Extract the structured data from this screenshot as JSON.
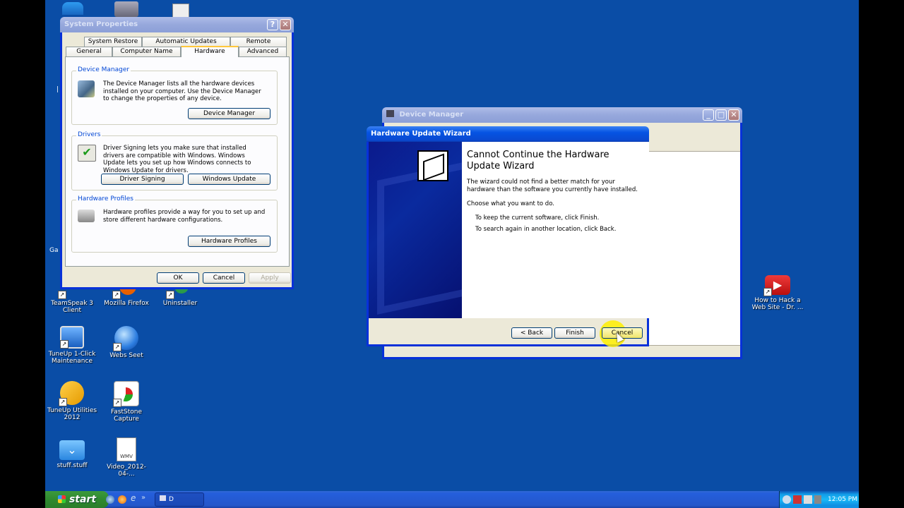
{
  "desktop_icons": [
    {
      "label": "TeamSpeak 3 Client",
      "icon": "teamspeak-icon"
    },
    {
      "label": "Mozilla Firefox",
      "icon": "firefox-icon"
    },
    {
      "label": "Uninstaller",
      "icon": "uninstaller-icon"
    },
    {
      "label": "TuneUp 1-Click Maintenance",
      "icon": "tuneup-maintenance-icon"
    },
    {
      "label": "Webs Seet",
      "icon": "globe-icon"
    },
    {
      "label": "TuneUp Utilities 2012",
      "icon": "tuneup-utilities-icon"
    },
    {
      "label": "FastStone Capture",
      "icon": "faststone-icon"
    },
    {
      "label": "stuff.stuff",
      "icon": "folder-download-icon"
    },
    {
      "label": "Video_2012-04-...",
      "icon": "wmv-file-icon"
    },
    {
      "label": "How to Hack a Web Site - Dr. ...",
      "icon": "youtube-icon"
    }
  ],
  "partial_desktop_label": "Ga",
  "system_properties": {
    "title": "System Properties",
    "tabs_top": [
      "System Restore",
      "Automatic Updates",
      "Remote"
    ],
    "tabs_bottom": [
      "General",
      "Computer Name",
      "Hardware",
      "Advanced"
    ],
    "active_tab": "Hardware",
    "device_manager": {
      "title": "Device Manager",
      "text": "The Device Manager lists all the hardware devices installed on your computer. Use the Device Manager to change the properties of any device.",
      "button": "Device Manager"
    },
    "drivers": {
      "title": "Drivers",
      "text": "Driver Signing lets you make sure that installed drivers are compatible with Windows. Windows Update lets you set up how Windows connects to Windows Update for drivers.",
      "button1": "Driver Signing",
      "button2": "Windows Update"
    },
    "hardware_profiles": {
      "title": "Hardware Profiles",
      "text": "Hardware profiles provide a way for you to set up and store different hardware configurations.",
      "button": "Hardware Profiles"
    },
    "ok": "OK",
    "cancel": "Cancel",
    "apply": "Apply"
  },
  "device_manager_window": {
    "title": "Device Manager"
  },
  "wizard": {
    "title": "Hardware Update Wizard",
    "heading": "Cannot Continue the Hardware Update Wizard",
    "text1": "The wizard could not find a better match for your hardware than the software you currently have installed.",
    "text2": "Choose what you want to do.",
    "text3": "To keep the current software, click Finish.",
    "text4": "To search again in another location, click Back.",
    "back": "< Back",
    "finish": "Finish",
    "cancel": "Cancel"
  },
  "taskbar": {
    "start": "start",
    "task_label": "D",
    "clock": "12:05 PM"
  },
  "colors": {
    "desktop": "#0a4da6",
    "title_active": "#0554e3",
    "highlight": "#ffee00"
  }
}
